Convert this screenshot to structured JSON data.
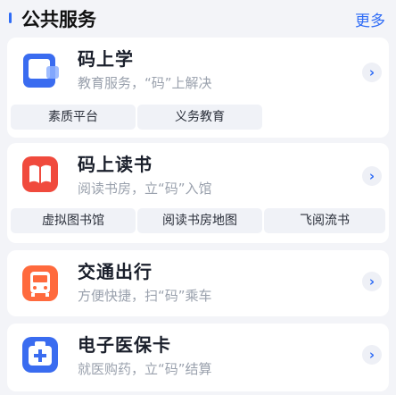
{
  "header": {
    "title": "公共服务",
    "more_label": "更多"
  },
  "services": [
    {
      "title": "码上学",
      "subtitle": "教育服务，“码”上解决",
      "icon": "tablet-icon",
      "chips": [
        "素质平台",
        "义务教育"
      ]
    },
    {
      "title": "码上读书",
      "subtitle": "阅读书房，立“码”入馆",
      "icon": "open-book-icon",
      "chips": [
        "虚拟图书馆",
        "阅读书房地图",
        "飞阅流书"
      ]
    },
    {
      "title": "交通出行",
      "subtitle": "方便快捷，扫“码”乘车",
      "icon": "bus-icon",
      "chips": []
    },
    {
      "title": "电子医保卡",
      "subtitle": "就医购药，立“码”结算",
      "icon": "medical-kit-icon",
      "chips": []
    }
  ],
  "chevron_glyph": "›",
  "colors": {
    "accent": "#2f6cf6",
    "icon_blue": "#3a6cf0",
    "icon_red": "#f04a3d",
    "icon_orange": "#ff6a3d",
    "chip_bg": "#f0f2f7"
  }
}
